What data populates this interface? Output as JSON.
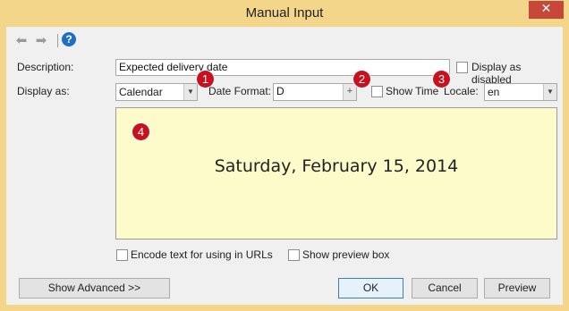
{
  "window": {
    "title": "Manual Input"
  },
  "titlebar": {
    "close_glyph": "✕"
  },
  "toolbar": {
    "back_icon": "arrow-left-icon",
    "forward_icon": "arrow-right-icon",
    "help_icon": "help-icon",
    "back_glyph": "⬅",
    "forward_glyph": "➡",
    "help_glyph": "?"
  },
  "form": {
    "description_label": "Description:",
    "description_value": "Expected delivery date",
    "display_disabled_label": "Display as disabled",
    "display_as_label": "Display as:",
    "display_as_value": "Calendar",
    "date_format_label": "Date Format:",
    "date_format_value": "D",
    "show_time_label": "Show Time",
    "locale_label": "Locale:",
    "locale_value": "en"
  },
  "preview": {
    "text": "Saturday, February 15, 2014"
  },
  "options": {
    "encode_label": "Encode text for using in URLs",
    "show_preview_label": "Show preview box"
  },
  "buttons": {
    "advanced": "Show Advanced >>",
    "ok": "OK",
    "cancel": "Cancel",
    "preview": "Preview"
  },
  "badges": [
    "1",
    "2",
    "3",
    "4"
  ],
  "colors": {
    "titlebar": "#f4d68a",
    "close": "#c7483a",
    "badge": "#c8111f",
    "preview_bg": "#fdfbc9",
    "help": "#1e6fc1"
  }
}
